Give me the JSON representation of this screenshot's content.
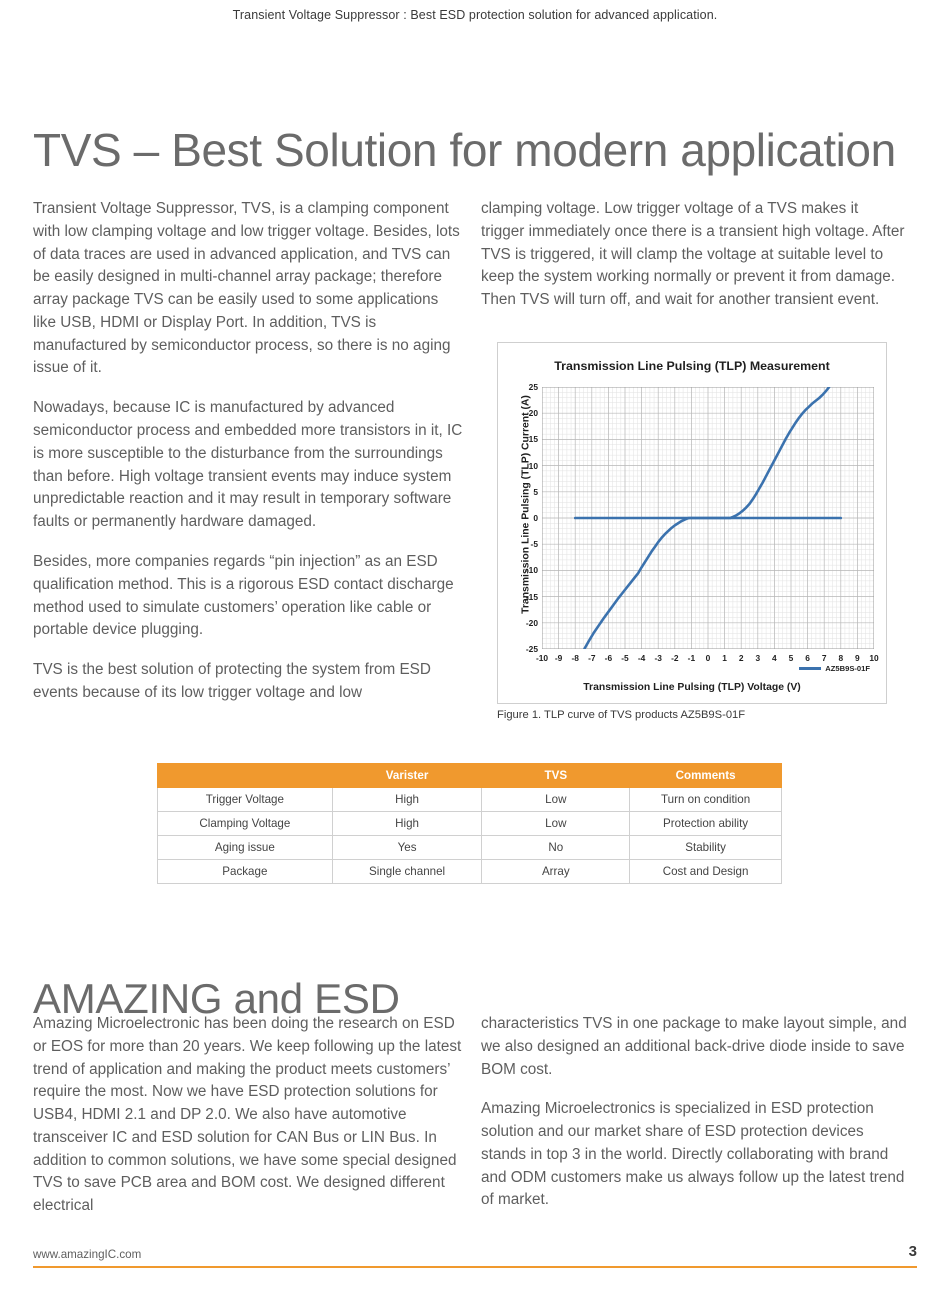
{
  "running_header": "Transient Voltage Suppressor : Best ESD protection solution for advanced application.",
  "page_title": "TVS – Best Solution for modern application",
  "column_left": [
    "Transient Voltage Suppressor, TVS, is a clamping component with low clamping voltage and low trigger voltage. Besides, lots of data traces are used in advanced application, and TVS can be easily designed in multi-channel array package; therefore array package TVS can be easily used to some applications like USB, HDMI or Display Port. In addition, TVS is manufactured by semiconductor process, so there is no aging issue of it.",
    "Nowadays, because IC is manufactured by advanced semiconductor process and embedded more transistors in it, IC is more susceptible to the disturbance from the surroundings than before. High voltage transient events may induce system unpredictable reaction and it may result in temporary software faults or permanently hardware damaged.",
    "Besides, more companies regards “pin injection” as an ESD qualification method. This is a rigorous ESD contact discharge method used to simulate customers’ operation like cable or portable device plugging.",
    "TVS is the best solution of protecting the system from ESD events because of its low trigger voltage and low"
  ],
  "column_right": [
    "clamping voltage. Low trigger voltage of a TVS makes it trigger immediately once there is a transient high voltage. After TVS is triggered, it will clamp the voltage at suitable level to keep the system working normally or prevent it from damage. Then TVS will turn off, and wait for another transient event."
  ],
  "figure": {
    "caption": "Figure 1. TLP curve of TVS products AZ5B9S-01F"
  },
  "chart_data": {
    "type": "line",
    "title": "Transmission Line Pulsing (TLP) Measurement",
    "xlabel": "Transmission Line Pulsing (TLP) Voltage (V)",
    "ylabel": "Transmission Line Pulsing (TLP) Current (A)",
    "xlim": [
      -10,
      10
    ],
    "ylim": [
      -25,
      25
    ],
    "xticks": [
      -10,
      -9,
      -8,
      -7,
      -6,
      -5,
      -4,
      -3,
      -2,
      -1,
      0,
      1,
      2,
      3,
      4,
      5,
      6,
      7,
      8,
      9,
      10
    ],
    "yticks": [
      25,
      20,
      15,
      10,
      5,
      0,
      -5,
      -10,
      -15,
      -20,
      -25
    ],
    "grid": true,
    "minor_grid": true,
    "legend_position": "bottom-right",
    "series": [
      {
        "name": "AZ5B9S-01F",
        "color": "#3b72ae",
        "points": [
          [
            -7.45,
            -25.0
          ],
          [
            -7.2,
            -23.6
          ],
          [
            -6.9,
            -22.0
          ],
          [
            -6.6,
            -20.6
          ],
          [
            -6.3,
            -19.2
          ],
          [
            -6.0,
            -17.9
          ],
          [
            -5.7,
            -16.6
          ],
          [
            -5.4,
            -15.3
          ],
          [
            -5.1,
            -14.1
          ],
          [
            -4.8,
            -12.9
          ],
          [
            -4.5,
            -11.7
          ],
          [
            -4.2,
            -10.5
          ],
          [
            -4.0,
            -9.4
          ],
          [
            -3.8,
            -8.4
          ],
          [
            -3.6,
            -7.4
          ],
          [
            -3.4,
            -6.4
          ],
          [
            -3.2,
            -5.5
          ],
          [
            -3.0,
            -4.6
          ],
          [
            -2.8,
            -3.8
          ],
          [
            -2.6,
            -3.1
          ],
          [
            -2.4,
            -2.5
          ],
          [
            -2.2,
            -1.9
          ],
          [
            -2.0,
            -1.4
          ],
          [
            -1.8,
            -1.0
          ],
          [
            -1.6,
            -0.6
          ],
          [
            -1.4,
            -0.3
          ],
          [
            -1.25,
            -0.1
          ],
          [
            -1.15,
            0.0
          ],
          [
            -1.0,
            0.0
          ],
          [
            0.0,
            0.0
          ],
          [
            1.0,
            0.0
          ],
          [
            1.35,
            0.0
          ],
          [
            1.5,
            0.2
          ],
          [
            1.7,
            0.5
          ],
          [
            1.9,
            0.9
          ],
          [
            2.1,
            1.4
          ],
          [
            2.3,
            2.0
          ],
          [
            2.5,
            2.7
          ],
          [
            2.7,
            3.6
          ],
          [
            2.9,
            4.6
          ],
          [
            3.1,
            5.7
          ],
          [
            3.3,
            6.8
          ],
          [
            3.5,
            8.0
          ],
          [
            3.7,
            9.2
          ],
          [
            3.9,
            10.4
          ],
          [
            4.1,
            11.6
          ],
          [
            4.3,
            12.8
          ],
          [
            4.5,
            14.0
          ],
          [
            4.7,
            15.2
          ],
          [
            4.9,
            16.3
          ],
          [
            5.1,
            17.3
          ],
          [
            5.3,
            18.3
          ],
          [
            5.5,
            19.2
          ],
          [
            5.7,
            20.0
          ],
          [
            5.9,
            20.7
          ],
          [
            6.1,
            21.3
          ],
          [
            6.3,
            21.9
          ],
          [
            6.5,
            22.4
          ],
          [
            6.7,
            22.9
          ],
          [
            6.9,
            23.5
          ],
          [
            7.1,
            24.2
          ],
          [
            7.3,
            25.0
          ]
        ]
      },
      {
        "name": "zero-baseline",
        "color": "#3b72ae",
        "points": [
          [
            -8.0,
            0.0
          ],
          [
            8.0,
            0.0
          ]
        ]
      }
    ]
  },
  "comparison_table": {
    "headers": [
      "",
      "Varister",
      "TVS",
      "Comments"
    ],
    "rows": [
      [
        "Trigger Voltage",
        "High",
        "Low",
        "Turn on condition"
      ],
      [
        "Clamping Voltage",
        "High",
        "Low",
        "Protection ability"
      ],
      [
        "Aging issue",
        "Yes",
        "No",
        "Stability"
      ],
      [
        "Package",
        "Single channel",
        "Array",
        "Cost and Design"
      ]
    ],
    "header_color": "#f0992e"
  },
  "section2": {
    "title": "AMAZING and ESD",
    "column_left": [
      "Amazing Microelectronic has been doing the research on ESD or EOS for more than 20 years. We keep following up the latest trend of application and making the product meets customers’ require the most. Now we have ESD protection solutions for USB4, HDMI 2.1 and DP 2.0. We also have automotive transceiver IC and ESD solution for CAN Bus or LIN Bus. In addition to common solutions, we have some special designed TVS to save PCB area and BOM cost. We designed different electrical"
    ],
    "column_right": [
      "characteristics TVS in one package to make layout simple, and we also designed an additional back-drive diode inside to save BOM cost.",
      "Amazing Microelectronics is specialized in ESD protection solution and our market share of ESD protection devices stands in top 3 in the world. Directly collaborating with brand and ODM customers make us always follow up the latest trend of market."
    ]
  },
  "footer": {
    "url": "www.amazingIC.com",
    "page_number": "3",
    "rule_color": "#f0992e"
  }
}
